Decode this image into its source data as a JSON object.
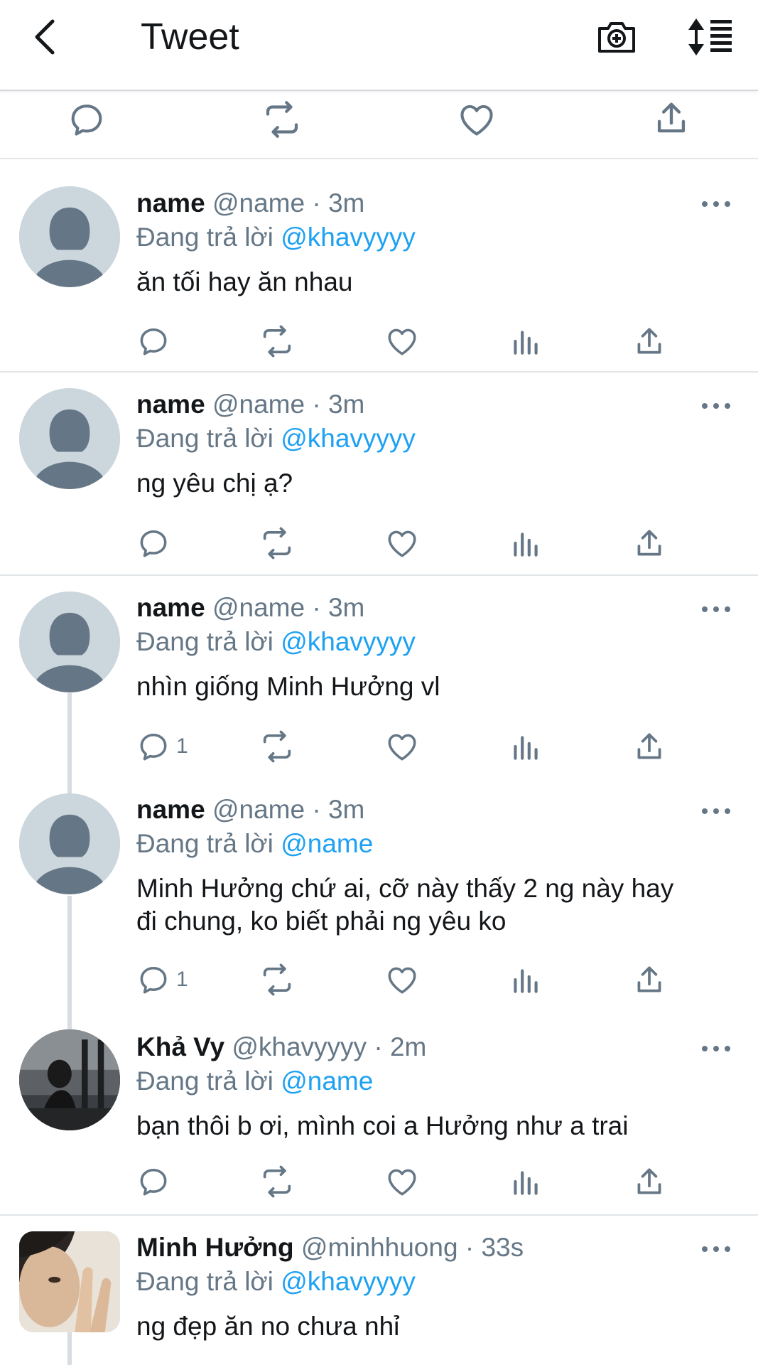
{
  "header": {
    "title": "Tweet"
  },
  "replies": [
    {
      "name": "name",
      "handle": "@name",
      "sep": "·",
      "time": "3m",
      "replying_prefix": "Đang trả lời",
      "replying_to": "@khavyyyy",
      "text": "ăn tối hay ăn nhau",
      "reply_count": ""
    },
    {
      "name": "name",
      "handle": "@name",
      "sep": "·",
      "time": "3m",
      "replying_prefix": "Đang trả lời",
      "replying_to": "@khavyyyy",
      "text": "ng yêu chị ạ?",
      "reply_count": ""
    },
    {
      "name": "name",
      "handle": "@name",
      "sep": "·",
      "time": "3m",
      "replying_prefix": "Đang trả lời",
      "replying_to": "@khavyyyy",
      "text": "nhìn giống Minh Hưởng vl",
      "reply_count": "1"
    },
    {
      "name": "name",
      "handle": "@name",
      "sep": "·",
      "time": "3m",
      "replying_prefix": "Đang trả lời",
      "replying_to": "@name",
      "text_line1": "Minh Hưởng chứ ai, cỡ này thấy 2 ng này hay",
      "text_line2": "đi chung, ko biết phải ng yêu ko",
      "reply_count": "1"
    },
    {
      "name": "Khả Vy",
      "handle": "@khavyyyy",
      "sep": "·",
      "time": "2m",
      "replying_prefix": "Đang trả lời",
      "replying_to": "@name",
      "text": "bạn thôi b ơi, mình coi a Hưởng như a trai",
      "reply_count": ""
    },
    {
      "name": "Minh Hưởng",
      "handle": "@minhhuong",
      "sep": "·",
      "time": "33s",
      "replying_prefix": "Đang trả lời",
      "replying_to": "@khavyyyy",
      "text": "ng đẹp ăn no chưa nhỉ"
    }
  ],
  "icons": {
    "back": "chevron-left-icon",
    "camera": "camera-plus-icon",
    "sort": "sort-icon",
    "reply": "reply-icon",
    "retweet": "retweet-icon",
    "like": "heart-icon",
    "analytics": "analytics-icon",
    "share": "share-icon",
    "more": "more-icon"
  },
  "colors": {
    "link": "#1da1f2",
    "secondary": "#657786",
    "avatar_bg": "#ccd6dd",
    "avatar_fg": "#657786"
  }
}
